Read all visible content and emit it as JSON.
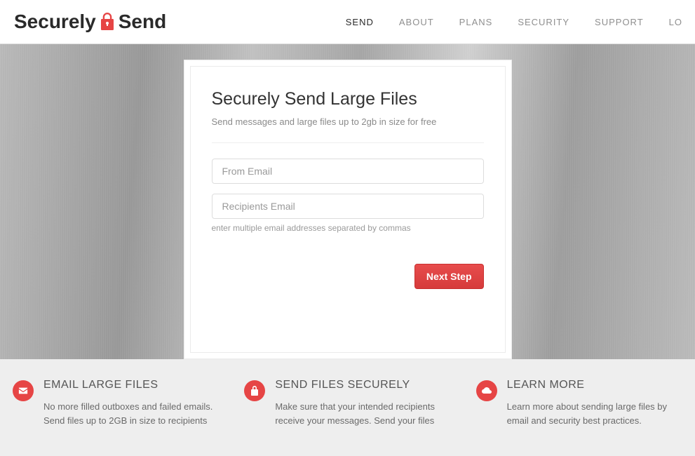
{
  "brand": {
    "part1": "Securely",
    "part2": "Send"
  },
  "nav": {
    "items": [
      {
        "label": "SEND",
        "active": true
      },
      {
        "label": "ABOUT",
        "active": false
      },
      {
        "label": "PLANS",
        "active": false
      },
      {
        "label": "SECURITY",
        "active": false
      },
      {
        "label": "SUPPORT",
        "active": false
      },
      {
        "label": "LO",
        "active": false
      }
    ]
  },
  "form": {
    "title": "Securely Send Large Files",
    "subtitle": "Send messages and large files up to 2gb in size for free",
    "from_placeholder": "From Email",
    "recipients_placeholder": "Recipients Email",
    "recipients_help": "enter multiple email addresses separated by commas",
    "submit_label": "Next Step"
  },
  "features": [
    {
      "icon": "envelope-icon",
      "title": "EMAIL LARGE FILES",
      "desc": "No more filled outboxes and failed emails. Send files up to 2GB in size to recipients"
    },
    {
      "icon": "lock-icon",
      "title": "SEND FILES SECURELY",
      "desc": "Make sure that your intended recipients receive your messages. Send your files"
    },
    {
      "icon": "cloud-icon",
      "title": "LEARN MORE",
      "desc": "Learn more about sending large files by email and security best practices."
    }
  ]
}
